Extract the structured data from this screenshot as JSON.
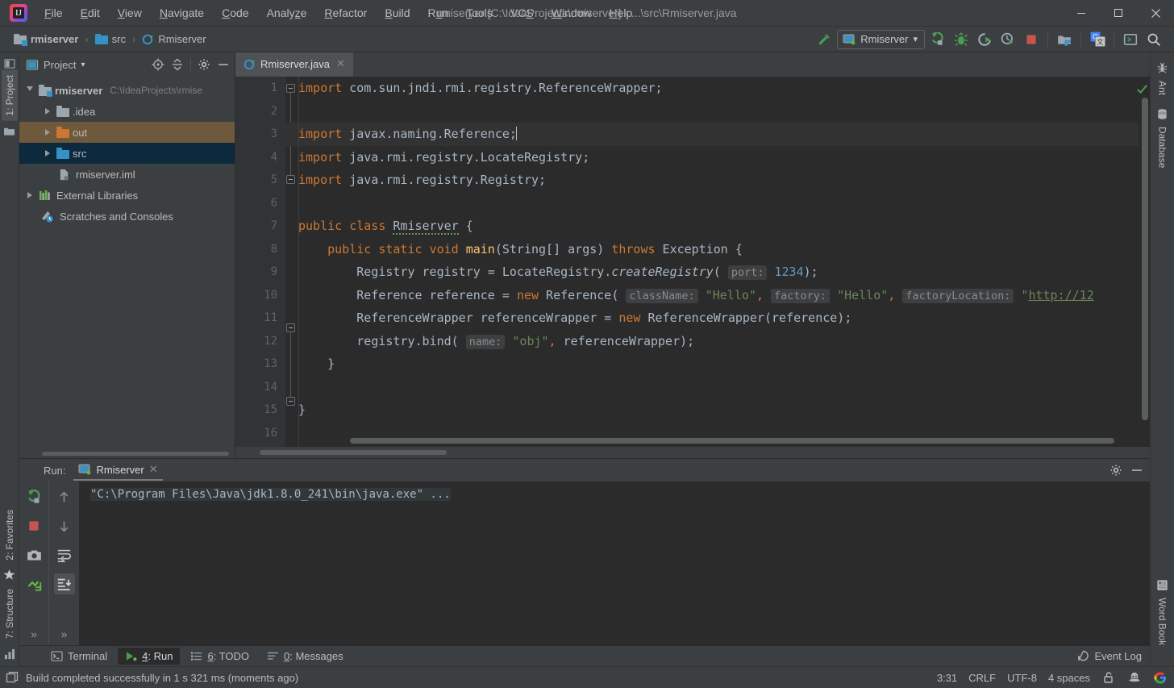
{
  "window": {
    "title": "rmiserver [C:\\IdeaProjects\\rmiserver] - ...\\src\\Rmiserver.java",
    "minimize": "—",
    "maximize": "▢",
    "close": "✕"
  },
  "menu": {
    "items": [
      {
        "label": "File",
        "mnemonic": "F"
      },
      {
        "label": "Edit",
        "mnemonic": "E"
      },
      {
        "label": "View",
        "mnemonic": "V"
      },
      {
        "label": "Navigate",
        "mnemonic": "N"
      },
      {
        "label": "Code",
        "mnemonic": "C"
      },
      {
        "label": "Analyze",
        "mnemonic": "z"
      },
      {
        "label": "Refactor",
        "mnemonic": "R"
      },
      {
        "label": "Build",
        "mnemonic": "B"
      },
      {
        "label": "Run",
        "mnemonic": "u"
      },
      {
        "label": "Tools",
        "mnemonic": "T"
      },
      {
        "label": "VCS",
        "mnemonic": "S"
      },
      {
        "label": "Window",
        "mnemonic": "W"
      },
      {
        "label": "Help",
        "mnemonic": "H"
      }
    ]
  },
  "navbar": {
    "breadcrumbs": [
      {
        "label": "rmiserver",
        "icon": "module-icon"
      },
      {
        "label": "src",
        "icon": "folder-icon"
      },
      {
        "label": "Rmiserver",
        "icon": "java-class-icon"
      }
    ],
    "separator": "›",
    "run_config": "Rmiserver",
    "dropdown_caret": "▾",
    "icons": [
      "build-hammer-icon",
      "run-icon",
      "debug-icon",
      "run-with-coverage-icon",
      "profiler-icon",
      "stop-icon",
      "project-structure-icon",
      "translate-icon",
      "terminal-icon",
      "search-everywhere-icon"
    ]
  },
  "left_tool_strip": {
    "tabs": [
      "1: Project",
      "2: Favorites",
      "7: Structure"
    ]
  },
  "right_tool_strip": {
    "tabs": [
      "Ant",
      "Database",
      "Word Book"
    ]
  },
  "project_panel": {
    "title": "Project",
    "caret": "▾",
    "header_icons": [
      "locate-icon",
      "collapse-all-icon",
      "settings-gear-icon",
      "hide-icon"
    ],
    "tree": [
      {
        "label": "rmiserver",
        "path": "C:\\IdeaProjects\\rmise",
        "depth": 0,
        "expanded": true,
        "icon": "module-icon",
        "state": "normal"
      },
      {
        "label": ".idea",
        "path": "",
        "depth": 1,
        "expanded": false,
        "icon": "folder-grey-icon",
        "state": "normal"
      },
      {
        "label": "out",
        "path": "",
        "depth": 1,
        "expanded": false,
        "icon": "folder-orange-icon",
        "state": "highlighted"
      },
      {
        "label": "src",
        "path": "",
        "depth": 1,
        "expanded": false,
        "icon": "folder-blue-icon",
        "state": "selected"
      },
      {
        "label": "rmiserver.iml",
        "path": "",
        "depth": 2,
        "expanded": null,
        "icon": "iml-file-icon",
        "state": "normal"
      },
      {
        "label": "External Libraries",
        "path": "",
        "depth": 0,
        "expanded": false,
        "icon": "libraries-icon",
        "state": "normal"
      },
      {
        "label": "Scratches and Consoles",
        "path": "",
        "depth": 0,
        "expanded": null,
        "icon": "scratches-icon",
        "state": "normal"
      }
    ]
  },
  "editor": {
    "tab": {
      "label": "Rmiserver.java",
      "close": "✕",
      "icon": "java-class-icon"
    },
    "lines": [
      {
        "n": 1,
        "gutter": "fold-start",
        "current": false
      },
      {
        "n": 2,
        "gutter": "",
        "current": false
      },
      {
        "n": 3,
        "gutter": "",
        "current": true
      },
      {
        "n": 4,
        "gutter": "",
        "current": false
      },
      {
        "n": 5,
        "gutter": "fold-end",
        "current": false
      },
      {
        "n": 6,
        "gutter": "",
        "current": false
      },
      {
        "n": 7,
        "gutter": "run-marker",
        "current": false
      },
      {
        "n": 8,
        "gutter": "run-marker-fold",
        "current": false
      },
      {
        "n": 9,
        "gutter": "",
        "current": false
      },
      {
        "n": 10,
        "gutter": "",
        "current": false
      },
      {
        "n": 11,
        "gutter": "",
        "current": false
      },
      {
        "n": 12,
        "gutter": "",
        "current": false
      },
      {
        "n": 13,
        "gutter": "fold-end",
        "current": false
      },
      {
        "n": 14,
        "gutter": "",
        "current": false
      },
      {
        "n": 15,
        "gutter": "",
        "current": false
      },
      {
        "n": 16,
        "gutter": "",
        "current": false
      }
    ],
    "code_text": [
      "import com.sun.jndi.rmi.registry.ReferenceWrapper;",
      "",
      "import javax.naming.Reference;",
      "import java.rmi.registry.LocateRegistry;",
      "import java.rmi.registry.Registry;",
      "",
      "public class Rmiserver {",
      "    public static void main(String[] args) throws Exception {",
      "        Registry registry = LocateRegistry.createRegistry( port: 1234);",
      "        Reference reference = new Reference( className: \"Hello\", factory: \"Hello\", factoryLocation: \"http://12",
      "        ReferenceWrapper referenceWrapper = new ReferenceWrapper(reference);",
      "        registry.bind( name: \"obj\", referenceWrapper);",
      "    }",
      "",
      "}",
      ""
    ],
    "inlay_hints": [
      "port:",
      "className:",
      "factory:",
      "factoryLocation:",
      "name:"
    ],
    "inspection_status": "ok-checkmark"
  },
  "run_panel": {
    "label": "Run:",
    "tab": "Rmiserver",
    "tab_close": "✕",
    "header_icons": [
      "settings-gear-icon",
      "hide-icon"
    ],
    "toolbar_left": [
      "rerun-icon",
      "stop-icon",
      "dump-threads-icon",
      "trace-icon",
      "expand-more-icon"
    ],
    "toolbar_right": [
      "up-arrow-icon",
      "down-arrow-icon",
      "soft-wrap-icon",
      "scroll-to-end-icon",
      "expand-more-icon"
    ],
    "console_line": "\"C:\\Program Files\\Java\\jdk1.8.0_241\\bin\\java.exe\" ..."
  },
  "bottom_bar": {
    "tabs": [
      {
        "label": "Terminal",
        "mnemonic": "",
        "icon": "terminal-icon",
        "active": false
      },
      {
        "label": "4: Run",
        "mnemonic": "4",
        "icon": "run-icon",
        "active": true
      },
      {
        "label": "6: TODO",
        "mnemonic": "6",
        "icon": "todo-icon",
        "active": false
      },
      {
        "label": "0: Messages",
        "mnemonic": "0",
        "icon": "messages-icon",
        "active": false
      }
    ],
    "event_log": "Event Log",
    "event_log_icon": "balloon-icon"
  },
  "status_bar": {
    "message": "Build completed successfully in 1 s 321 ms (moments ago)",
    "message_icon": "build-info-icon",
    "caret_position": "3:31",
    "line_separator": "CRLF",
    "encoding": "UTF-8",
    "indent": "4 spaces",
    "icons": [
      "lock-open-icon",
      "inspector-hat-icon",
      "google-icon"
    ]
  },
  "colors": {
    "background": "#3c3f41",
    "editor_bg": "#2b2b2b",
    "selection_blue": "#0d293e",
    "highlight_amber": "#6e593c",
    "keyword_orange": "#cc7832",
    "string_green": "#6a8759",
    "number_blue": "#6897bb",
    "method_yellow": "#ffc66d",
    "text": "#a9b7c6",
    "green_accent": "#499c54"
  }
}
